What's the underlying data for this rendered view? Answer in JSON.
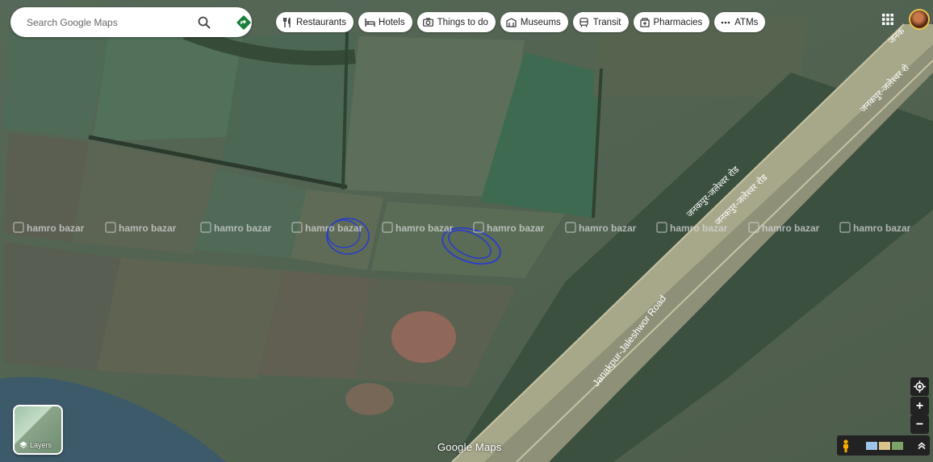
{
  "search": {
    "placeholder": "Search Google Maps"
  },
  "chips": [
    {
      "label": "Restaurants",
      "icon": "fork-knife-icon"
    },
    {
      "label": "Hotels",
      "icon": "bed-icon"
    },
    {
      "label": "Things to do",
      "icon": "camera-icon"
    },
    {
      "label": "Museums",
      "icon": "museum-icon"
    },
    {
      "label": "Transit",
      "icon": "train-icon"
    },
    {
      "label": "Pharmacies",
      "icon": "pharmacy-icon"
    },
    {
      "label": "ATMs",
      "icon": "more-icon"
    }
  ],
  "map": {
    "road_label_en": "Janakpur-Jaleshwor Road",
    "road_label_np": "जनकपुर-जलेश्वर रोड",
    "road_label_np_top": "जनकपुर-जलेश्वर रो",
    "road_label_np_corner": "जनक",
    "watermark_text": "hamro bazar"
  },
  "layers": {
    "label": "Layers"
  },
  "logo": "Google Maps",
  "zoom": {
    "in": "+",
    "out": "−"
  },
  "colors": {
    "accent": "#1a73e8",
    "directions": "#188038"
  }
}
